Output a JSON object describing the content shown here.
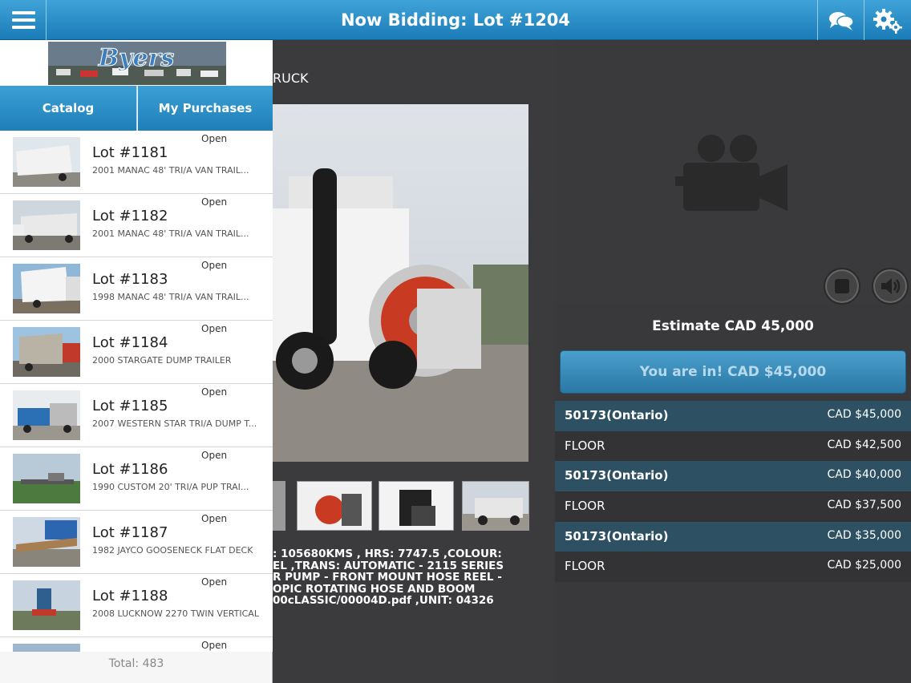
{
  "header": {
    "title": "Now Bidding: Lot #1204",
    "menu_icon": "hamburger-menu-icon",
    "chat_icon": "chat-bubbles-icon",
    "settings_icon": "gears-icon",
    "accent_color": "#2a8fcb"
  },
  "sidebar": {
    "logo_text": "Byers",
    "tabs": [
      {
        "label": "Catalog"
      },
      {
        "label": "My Purchases"
      }
    ],
    "lots": [
      {
        "status": "Open",
        "number": "Lot #1181",
        "description": "2001 MANAC 48' TRI/A VAN TRAIL..."
      },
      {
        "status": "Open",
        "number": "Lot #1182",
        "description": "2001 MANAC 48' TRI/A VAN TRAIL..."
      },
      {
        "status": "Open",
        "number": "Lot #1183",
        "description": "1998 MANAC 48' TRI/A VAN TRAIL..."
      },
      {
        "status": "Open",
        "number": "Lot #1184",
        "description": "2000 STARGATE DUMP TRAILER"
      },
      {
        "status": "Open",
        "number": "Lot #1185",
        "description": "2007 WESTERN STAR TRI/A DUMP T..."
      },
      {
        "status": "Open",
        "number": "Lot #1186",
        "description": "1990 CUSTOM 20' TRI/A PUP TRAI..."
      },
      {
        "status": "Open",
        "number": "Lot #1187",
        "description": "1982 JAYCO GOOSENECK FLAT DECK"
      },
      {
        "status": "Open",
        "number": "Lot #1188",
        "description": "2008 LUCKNOW 2270 TWIN VERTICAL"
      },
      {
        "status": "Open",
        "number": "",
        "description": ""
      }
    ],
    "total": "Total: 483"
  },
  "lot_detail": {
    "title_partial": "RUCK",
    "description_lines": [
      ": 105680KMS , HRS: 7747.5 ,COLOUR:",
      "EL ,TRANS: AUTOMATIC - 2115 SERIES",
      "R PUMP - FRONT MOUNT HOSE REEL -",
      "OPIC ROTATING HOSE AND BOOM",
      "00cLASSIC/00004D.pdf ,UNIT: 04326"
    ]
  },
  "bidding": {
    "video_icon": "video-camera-icon",
    "stop_icon": "stop-icon",
    "sound_icon": "speaker-icon",
    "estimate": "Estimate CAD 45,000",
    "bid_button": "You are in! CAD $45,000",
    "history": [
      {
        "bidder": "50173(Ontario)",
        "amount": "CAD $45,000",
        "type": "online"
      },
      {
        "bidder": "FLOOR",
        "amount": "CAD $42,500",
        "type": "floor"
      },
      {
        "bidder": "50173(Ontario)",
        "amount": "CAD $40,000",
        "type": "online"
      },
      {
        "bidder": "FLOOR",
        "amount": "CAD $37,500",
        "type": "floor"
      },
      {
        "bidder": "50173(Ontario)",
        "amount": "CAD $35,000",
        "type": "online"
      },
      {
        "bidder": "FLOOR",
        "amount": "CAD $25,000",
        "type": "floor"
      }
    ]
  }
}
